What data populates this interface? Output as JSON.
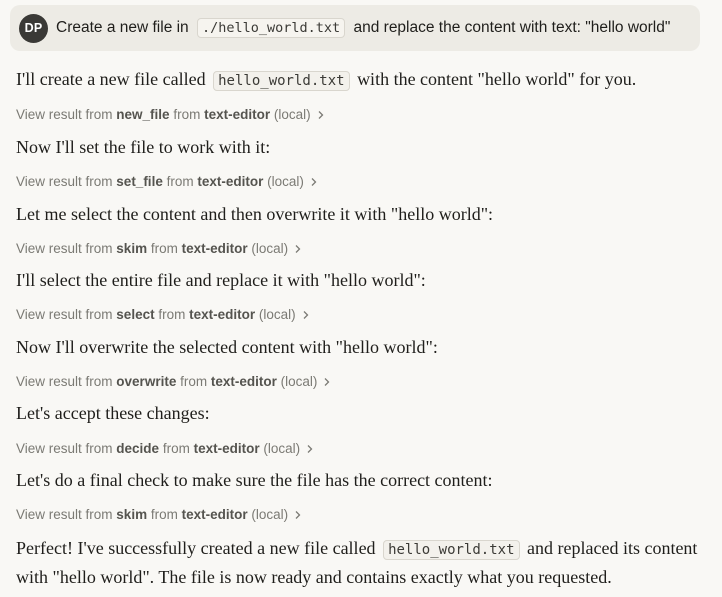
{
  "user": {
    "avatar_initials": "DP",
    "message_before": "Create a new file in",
    "message_code": "./hello_world.txt",
    "message_after": "and replace the content with text: \"hello world\""
  },
  "assistant": {
    "intro_before": "I'll create a new file called",
    "intro_code": "hello_world.txt",
    "intro_after": "with the content \"hello world\" for you.",
    "steps": [
      {
        "text": "Now I'll set the file to work with it:"
      },
      {
        "text": "Let me select the content and then overwrite it with \"hello world\":"
      },
      {
        "text": "I'll select the entire file and replace it with \"hello world\":"
      },
      {
        "text": "Now I'll overwrite the selected content with \"hello world\":"
      },
      {
        "text": "Let's accept these changes:"
      },
      {
        "text": "Let's do a final check to make sure the file has the correct content:"
      }
    ],
    "tool_results": [
      {
        "prefix": "View result from",
        "tool": "new_file",
        "mid": "from",
        "server": "text-editor",
        "suffix": "(local)"
      },
      {
        "prefix": "View result from",
        "tool": "set_file",
        "mid": "from",
        "server": "text-editor",
        "suffix": "(local)"
      },
      {
        "prefix": "View result from",
        "tool": "skim",
        "mid": "from",
        "server": "text-editor",
        "suffix": "(local)"
      },
      {
        "prefix": "View result from",
        "tool": "select",
        "mid": "from",
        "server": "text-editor",
        "suffix": "(local)"
      },
      {
        "prefix": "View result from",
        "tool": "overwrite",
        "mid": "from",
        "server": "text-editor",
        "suffix": "(local)"
      },
      {
        "prefix": "View result from",
        "tool": "decide",
        "mid": "from",
        "server": "text-editor",
        "suffix": "(local)"
      },
      {
        "prefix": "View result from",
        "tool": "skim",
        "mid": "from",
        "server": "text-editor",
        "suffix": "(local)"
      }
    ],
    "final_before": "Perfect! I've successfully created a new file called",
    "final_code": "hello_world.txt",
    "final_after": "and replaced its content with \"hello world\". The file is now ready and contains exactly what you requested."
  },
  "icons": {
    "tool_result_chevron": "chevron-right-icon"
  },
  "colors": {
    "background": "#f9f8f5",
    "user_bubble": "#edebe5",
    "avatar": "#3a3936",
    "muted_text": "#7b7a74"
  }
}
